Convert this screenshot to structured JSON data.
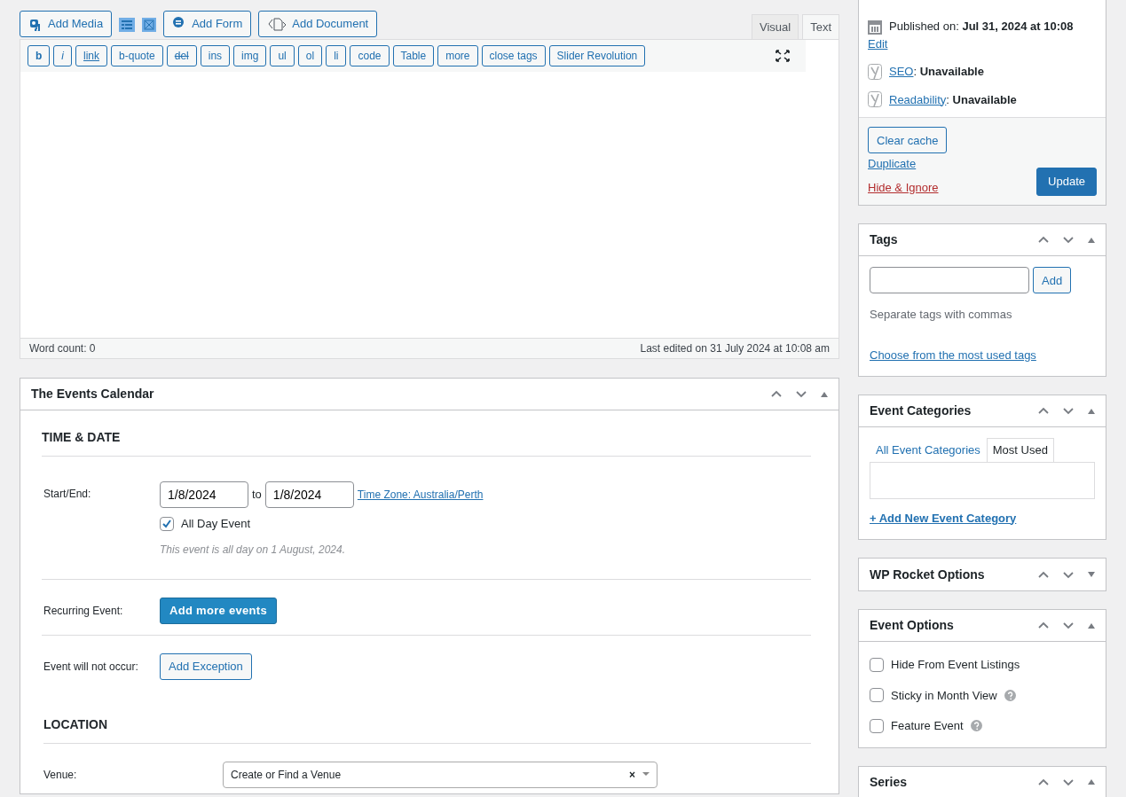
{
  "media_buttons": [
    {
      "kind": "text",
      "label": "Add Media"
    },
    {
      "kind": "icon"
    },
    {
      "kind": "icon"
    },
    {
      "kind": "text",
      "label": "Add Form"
    },
    {
      "kind": "text",
      "label": "Add Document"
    }
  ],
  "editor_tabs": [
    {
      "label": "Visual",
      "selected": false
    },
    {
      "label": "Text",
      "selected": true
    }
  ],
  "quicktags": [
    {
      "label": "b",
      "kind": "bold"
    },
    {
      "label": "i",
      "kind": "italic"
    },
    {
      "label": "link",
      "kind": "link"
    },
    {
      "label": "b-quote",
      "kind": "plain"
    },
    {
      "label": "del",
      "kind": "del"
    },
    {
      "label": "ins",
      "kind": "plain"
    },
    {
      "label": "img",
      "kind": "plain"
    },
    {
      "label": "ul",
      "kind": "plain"
    },
    {
      "label": "ol",
      "kind": "plain"
    },
    {
      "label": "li",
      "kind": "plain"
    },
    {
      "label": "code",
      "kind": "plain"
    },
    {
      "label": "Table",
      "kind": "plain"
    },
    {
      "label": "more",
      "kind": "plain"
    },
    {
      "label": "close tags",
      "kind": "plain"
    },
    {
      "label": "Slider Revolution",
      "kind": "plain"
    }
  ],
  "editor": {
    "word_count": "Word count: 0",
    "last_edited": "Last edited on 31 July 2024 at 10:08 am"
  },
  "events_calendar": {
    "title": "The Events Calendar",
    "expanded": true,
    "time_date": {
      "heading": "TIME & DATE",
      "start_end_label": "Start/End:",
      "start_date": "1/8/2024",
      "to": "to",
      "end_date": "1/8/2024",
      "timezone_link": "Time Zone: Australia/Perth",
      "all_day": {
        "label": "All Day Event",
        "checked": true
      },
      "note": "This event is all day on 1 August, 2024."
    },
    "recurring": {
      "label": "Recurring Event:",
      "button": "Add more events"
    },
    "exception": {
      "label": "Event will not occur:",
      "button": "Add Exception"
    },
    "location": {
      "heading": "LOCATION",
      "venue_label": "Venue:",
      "venue_value": "Create or Find a Venue",
      "clear": "×"
    }
  },
  "publish": {
    "published": "Published on: **Jul 31, 2024 at 10:08**",
    "edit_link": "Edit",
    "seo": [
      {
        "link": "SEO",
        "status": ": **Unavailable**"
      },
      {
        "link": "Readability",
        "status": ": **Unavailable**"
      }
    ],
    "clear_cache": "Clear cache",
    "duplicate": "Duplicate",
    "hide_ignore": "Hide & Ignore",
    "update": "Update"
  },
  "sidebar_panels": [
    {
      "kind": "tags",
      "title": "Tags",
      "expanded": true,
      "add_button": "Add",
      "hint": "Separate tags with commas",
      "link": "Choose from the most used tags"
    },
    {
      "kind": "categories",
      "title": "Event Categories",
      "expanded": true,
      "tabs": [
        {
          "label": "All Event Categories",
          "selected": false
        },
        {
          "label": "Most Used",
          "selected": true
        }
      ],
      "link": "+ Add New Event Category"
    },
    {
      "title": "WP Rocket Options",
      "expanded": false
    },
    {
      "kind": "options",
      "title": "Event Options",
      "expanded": true,
      "items": [
        {
          "label": "Hide From Event Listings",
          "checked": false,
          "help": false
        },
        {
          "label": "Sticky in Month View",
          "checked": false,
          "help": true
        },
        {
          "label": "Feature Event",
          "checked": false,
          "help": true
        }
      ]
    },
    {
      "title": "Series",
      "expanded": true
    }
  ]
}
